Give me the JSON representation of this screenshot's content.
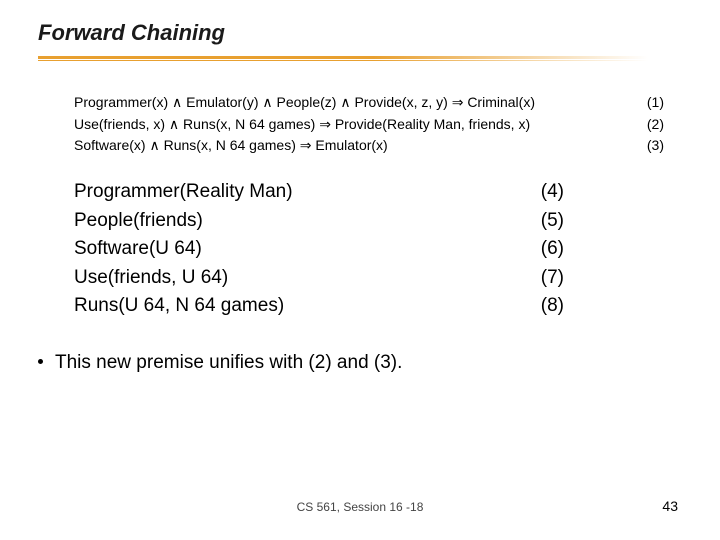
{
  "title": "Forward Chaining",
  "rules": [
    {
      "text": "Programmer(x) ∧ Emulator(y) ∧ People(z) ∧ Provide(x, z, y) ⇒ Criminal(x)",
      "num": "(1)"
    },
    {
      "text": "Use(friends, x) ∧ Runs(x, N 64 games) ⇒ Provide(Reality Man, friends, x)",
      "num": "(2)"
    },
    {
      "text": "Software(x) ∧ Runs(x, N 64 games) ⇒ Emulator(x)",
      "num": "(3)"
    }
  ],
  "facts": [
    {
      "text": "Programmer(Reality Man)",
      "num": "(4)"
    },
    {
      "text": "People(friends)",
      "num": "(5)"
    },
    {
      "text": "Software(U 64)",
      "num": "(6)"
    },
    {
      "text": "Use(friends, U 64)",
      "num": "(7)"
    },
    {
      "text": "Runs(U 64, N 64 games)",
      "num": "(8)"
    }
  ],
  "bullet": "This new premise unifies with (2) and (3).",
  "footer": "CS 561, Session 16 -18",
  "page": "43"
}
